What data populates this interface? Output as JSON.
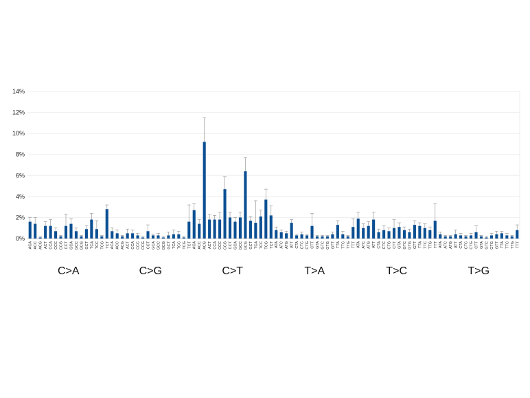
{
  "chart_data": {
    "type": "bar",
    "title": "",
    "xlabel": "",
    "ylabel": "",
    "ylim": [
      0,
      14
    ],
    "ytick_values": [
      0,
      2,
      4,
      6,
      8,
      10,
      12,
      14
    ],
    "ytick_labels": [
      "0%",
      "2%",
      "4%",
      "6%",
      "8%",
      "10%",
      "12%",
      "14%"
    ],
    "grid": true,
    "legend": "none",
    "bar_color": "#0b4f92",
    "error_bar_color": "#9a9a9a",
    "groups": [
      {
        "label": "C>A",
        "categories": [
          "ACA",
          "ACC",
          "ACG",
          "ACT",
          "CCA",
          "CCC",
          "CCG",
          "CCT",
          "GCA",
          "GCC",
          "GCG",
          "GCT",
          "TCA",
          "TCC",
          "TCG",
          "TCT"
        ],
        "values": [
          1.6,
          1.4,
          0.1,
          1.2,
          1.2,
          0.7,
          0.2,
          1.2,
          1.4,
          0.7,
          0.2,
          0.9,
          1.8,
          0.9,
          0.2,
          2.8
        ],
        "errors": [
          0.4,
          0.6,
          0.1,
          0.4,
          0.6,
          0.3,
          0.1,
          1.1,
          0.5,
          0.3,
          0.1,
          0.3,
          0.6,
          0.8,
          0.1,
          0.4
        ]
      },
      {
        "label": "C>G",
        "categories": [
          "ACA",
          "ACC",
          "ACG",
          "ACT",
          "CCA",
          "CCC",
          "CCG",
          "CCT",
          "GCA",
          "GCC",
          "GCG",
          "GCT",
          "TCA",
          "TCC",
          "TCG",
          "TCT"
        ],
        "values": [
          0.7,
          0.5,
          0.2,
          0.5,
          0.5,
          0.3,
          0.1,
          0.7,
          0.3,
          0.3,
          0.1,
          0.3,
          0.4,
          0.4,
          0.1,
          1.6
        ],
        "errors": [
          0.3,
          0.3,
          0.1,
          0.4,
          0.3,
          0.2,
          0.1,
          0.6,
          0.1,
          0.2,
          0.1,
          0.3,
          0.4,
          0.3,
          0.1,
          1.6
        ]
      },
      {
        "label": "C>T",
        "categories": [
          "ACA",
          "ACC",
          "ACG",
          "ACT",
          "CCA",
          "CCC",
          "CCG",
          "CCT",
          "GCA",
          "GCC",
          "GCG",
          "GCT",
          "TCA",
          "TCC",
          "TCG",
          "TCT"
        ],
        "values": [
          2.7,
          1.4,
          9.2,
          1.8,
          1.8,
          1.8,
          4.7,
          2.0,
          1.6,
          2.0,
          6.4,
          1.7,
          1.5,
          2.1,
          3.7,
          2.2
        ],
        "errors": [
          0.6,
          0.4,
          2.3,
          0.5,
          0.4,
          0.7,
          1.2,
          0.5,
          0.4,
          0.5,
          1.3,
          0.4,
          2.1,
          0.6,
          1.0,
          0.9
        ]
      },
      {
        "label": "T>A",
        "categories": [
          "ATA",
          "ATC",
          "ATG",
          "ATT",
          "CTA",
          "CTC",
          "CTG",
          "CTT",
          "GTA",
          "GTC",
          "GTG",
          "GTT",
          "TTA",
          "TTC",
          "TTG",
          "TTT"
        ],
        "values": [
          0.8,
          0.6,
          0.5,
          1.5,
          0.3,
          0.4,
          0.3,
          1.2,
          0.2,
          0.2,
          0.2,
          0.4,
          1.3,
          0.4,
          0.2,
          1.1
        ],
        "errors": [
          0.3,
          0.2,
          0.2,
          0.3,
          0.1,
          0.2,
          0.1,
          1.2,
          0.1,
          0.1,
          0.1,
          0.2,
          0.4,
          0.3,
          0.1,
          0.8
        ]
      },
      {
        "label": "T>C",
        "categories": [
          "ATA",
          "ATC",
          "ATG",
          "ATT",
          "CTA",
          "CTC",
          "CTG",
          "CTT",
          "GTA",
          "GTC",
          "GTG",
          "GTT",
          "TTA",
          "TTC",
          "TTG",
          "TTT"
        ],
        "values": [
          1.9,
          1.0,
          1.2,
          1.8,
          0.6,
          0.8,
          0.7,
          1.0,
          1.1,
          0.8,
          0.6,
          1.3,
          1.2,
          1.0,
          0.8,
          1.7
        ],
        "errors": [
          0.6,
          0.4,
          0.4,
          0.7,
          0.3,
          0.4,
          0.3,
          0.8,
          0.4,
          0.3,
          0.3,
          0.4,
          0.3,
          0.4,
          0.3,
          1.6
        ]
      },
      {
        "label": "T>G",
        "categories": [
          "ATA",
          "ATC",
          "ATG",
          "ATT",
          "CTA",
          "CTC",
          "CTG",
          "CTT",
          "GTA",
          "GTC",
          "GTG",
          "GTT",
          "TTA",
          "TTC",
          "TTG",
          "TTT"
        ],
        "values": [
          0.4,
          0.2,
          0.2,
          0.4,
          0.3,
          0.2,
          0.3,
          0.6,
          0.2,
          0.1,
          0.3,
          0.4,
          0.5,
          0.3,
          0.2,
          0.8
        ],
        "errors": [
          0.2,
          0.1,
          0.1,
          0.4,
          0.2,
          0.1,
          0.2,
          0.6,
          0.1,
          0.1,
          0.2,
          0.3,
          0.2,
          0.2,
          0.1,
          0.5
        ]
      }
    ]
  }
}
